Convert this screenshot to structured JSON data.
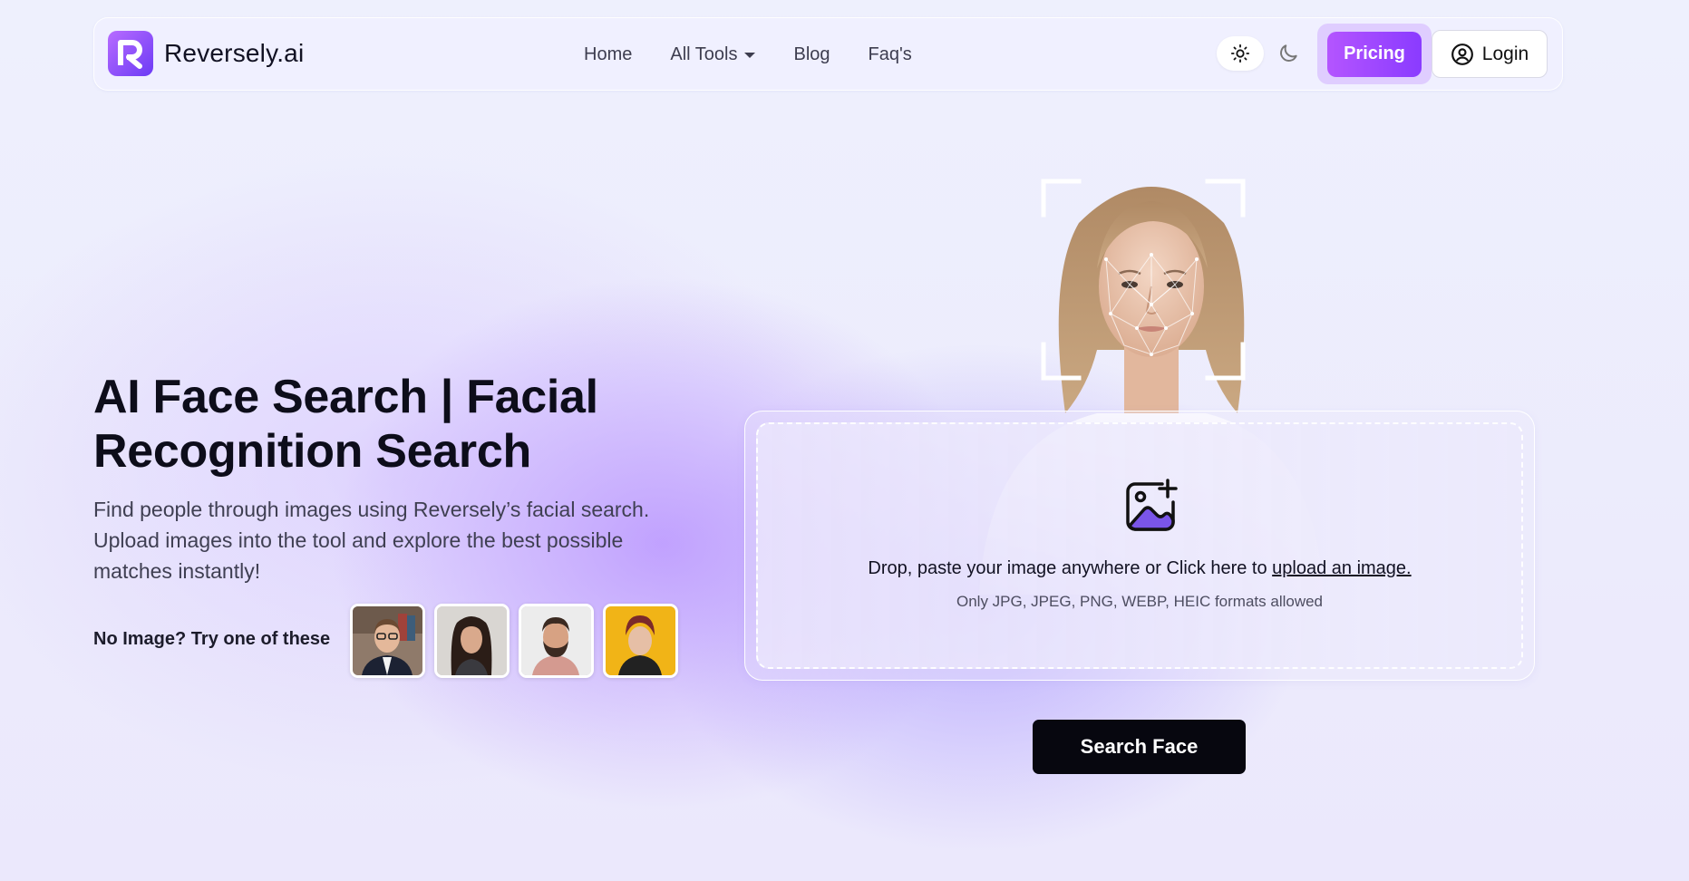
{
  "brand": {
    "name": "Reversely.ai",
    "accent": "#8a3bff",
    "logo_icon": "reversely-logo-icon"
  },
  "nav": {
    "links": [
      {
        "label": "Home"
      },
      {
        "label": "All Tools",
        "dropdown": true
      },
      {
        "label": "Blog"
      },
      {
        "label": "Faq's"
      }
    ],
    "theme_toggle": {
      "light_icon": "sun-icon",
      "dark_icon": "moon-icon",
      "active": "light"
    },
    "pricing_label": "Pricing",
    "login_label": "Login",
    "login_icon": "user-circle-icon"
  },
  "hero": {
    "title_line1": "AI Face Search | Facial",
    "title_line2": "Recognition Search",
    "description": "Find people through images using Reversely’s facial search. Upload images into the tool and explore the best possible matches instantly!",
    "samples_label": "No Image? Try one of these",
    "samples": [
      {
        "name": "man-with-glasses"
      },
      {
        "name": "woman-dark-hair"
      },
      {
        "name": "bearded-man"
      },
      {
        "name": "woman-yellow-background"
      }
    ]
  },
  "upload": {
    "icon": "image-add-icon",
    "prompt_prefix": "Drop, paste your image anywhere or Click here to ",
    "prompt_link": "upload an image.",
    "formats": "Only JPG, JPEG, PNG, WEBP, HEIC formats allowed"
  },
  "search_button_label": "Search Face"
}
